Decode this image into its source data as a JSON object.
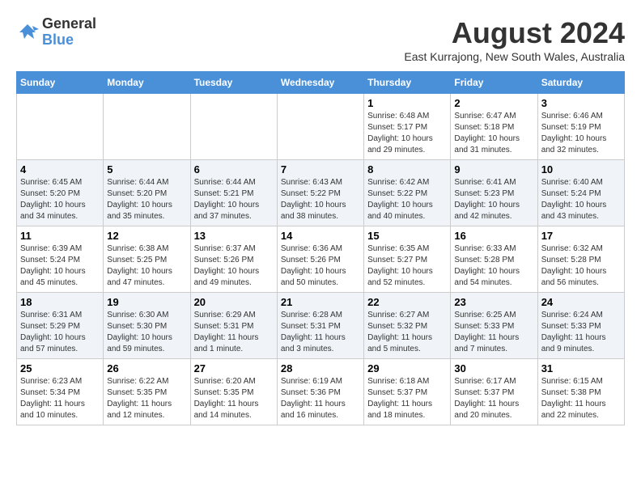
{
  "logo": {
    "line1": "General",
    "line2": "Blue"
  },
  "title": "August 2024",
  "subtitle": "East Kurrajong, New South Wales, Australia",
  "days_of_week": [
    "Sunday",
    "Monday",
    "Tuesday",
    "Wednesday",
    "Thursday",
    "Friday",
    "Saturday"
  ],
  "weeks": [
    [
      {
        "day": "",
        "info": ""
      },
      {
        "day": "",
        "info": ""
      },
      {
        "day": "",
        "info": ""
      },
      {
        "day": "",
        "info": ""
      },
      {
        "day": "1",
        "info": "Sunrise: 6:48 AM\nSunset: 5:17 PM\nDaylight: 10 hours\nand 29 minutes."
      },
      {
        "day": "2",
        "info": "Sunrise: 6:47 AM\nSunset: 5:18 PM\nDaylight: 10 hours\nand 31 minutes."
      },
      {
        "day": "3",
        "info": "Sunrise: 6:46 AM\nSunset: 5:19 PM\nDaylight: 10 hours\nand 32 minutes."
      }
    ],
    [
      {
        "day": "4",
        "info": "Sunrise: 6:45 AM\nSunset: 5:20 PM\nDaylight: 10 hours\nand 34 minutes."
      },
      {
        "day": "5",
        "info": "Sunrise: 6:44 AM\nSunset: 5:20 PM\nDaylight: 10 hours\nand 35 minutes."
      },
      {
        "day": "6",
        "info": "Sunrise: 6:44 AM\nSunset: 5:21 PM\nDaylight: 10 hours\nand 37 minutes."
      },
      {
        "day": "7",
        "info": "Sunrise: 6:43 AM\nSunset: 5:22 PM\nDaylight: 10 hours\nand 38 minutes."
      },
      {
        "day": "8",
        "info": "Sunrise: 6:42 AM\nSunset: 5:22 PM\nDaylight: 10 hours\nand 40 minutes."
      },
      {
        "day": "9",
        "info": "Sunrise: 6:41 AM\nSunset: 5:23 PM\nDaylight: 10 hours\nand 42 minutes."
      },
      {
        "day": "10",
        "info": "Sunrise: 6:40 AM\nSunset: 5:24 PM\nDaylight: 10 hours\nand 43 minutes."
      }
    ],
    [
      {
        "day": "11",
        "info": "Sunrise: 6:39 AM\nSunset: 5:24 PM\nDaylight: 10 hours\nand 45 minutes."
      },
      {
        "day": "12",
        "info": "Sunrise: 6:38 AM\nSunset: 5:25 PM\nDaylight: 10 hours\nand 47 minutes."
      },
      {
        "day": "13",
        "info": "Sunrise: 6:37 AM\nSunset: 5:26 PM\nDaylight: 10 hours\nand 49 minutes."
      },
      {
        "day": "14",
        "info": "Sunrise: 6:36 AM\nSunset: 5:26 PM\nDaylight: 10 hours\nand 50 minutes."
      },
      {
        "day": "15",
        "info": "Sunrise: 6:35 AM\nSunset: 5:27 PM\nDaylight: 10 hours\nand 52 minutes."
      },
      {
        "day": "16",
        "info": "Sunrise: 6:33 AM\nSunset: 5:28 PM\nDaylight: 10 hours\nand 54 minutes."
      },
      {
        "day": "17",
        "info": "Sunrise: 6:32 AM\nSunset: 5:28 PM\nDaylight: 10 hours\nand 56 minutes."
      }
    ],
    [
      {
        "day": "18",
        "info": "Sunrise: 6:31 AM\nSunset: 5:29 PM\nDaylight: 10 hours\nand 57 minutes."
      },
      {
        "day": "19",
        "info": "Sunrise: 6:30 AM\nSunset: 5:30 PM\nDaylight: 10 hours\nand 59 minutes."
      },
      {
        "day": "20",
        "info": "Sunrise: 6:29 AM\nSunset: 5:31 PM\nDaylight: 11 hours\nand 1 minute."
      },
      {
        "day": "21",
        "info": "Sunrise: 6:28 AM\nSunset: 5:31 PM\nDaylight: 11 hours\nand 3 minutes."
      },
      {
        "day": "22",
        "info": "Sunrise: 6:27 AM\nSunset: 5:32 PM\nDaylight: 11 hours\nand 5 minutes."
      },
      {
        "day": "23",
        "info": "Sunrise: 6:25 AM\nSunset: 5:33 PM\nDaylight: 11 hours\nand 7 minutes."
      },
      {
        "day": "24",
        "info": "Sunrise: 6:24 AM\nSunset: 5:33 PM\nDaylight: 11 hours\nand 9 minutes."
      }
    ],
    [
      {
        "day": "25",
        "info": "Sunrise: 6:23 AM\nSunset: 5:34 PM\nDaylight: 11 hours\nand 10 minutes."
      },
      {
        "day": "26",
        "info": "Sunrise: 6:22 AM\nSunset: 5:35 PM\nDaylight: 11 hours\nand 12 minutes."
      },
      {
        "day": "27",
        "info": "Sunrise: 6:20 AM\nSunset: 5:35 PM\nDaylight: 11 hours\nand 14 minutes."
      },
      {
        "day": "28",
        "info": "Sunrise: 6:19 AM\nSunset: 5:36 PM\nDaylight: 11 hours\nand 16 minutes."
      },
      {
        "day": "29",
        "info": "Sunrise: 6:18 AM\nSunset: 5:37 PM\nDaylight: 11 hours\nand 18 minutes."
      },
      {
        "day": "30",
        "info": "Sunrise: 6:17 AM\nSunset: 5:37 PM\nDaylight: 11 hours\nand 20 minutes."
      },
      {
        "day": "31",
        "info": "Sunrise: 6:15 AM\nSunset: 5:38 PM\nDaylight: 11 hours\nand 22 minutes."
      }
    ]
  ]
}
